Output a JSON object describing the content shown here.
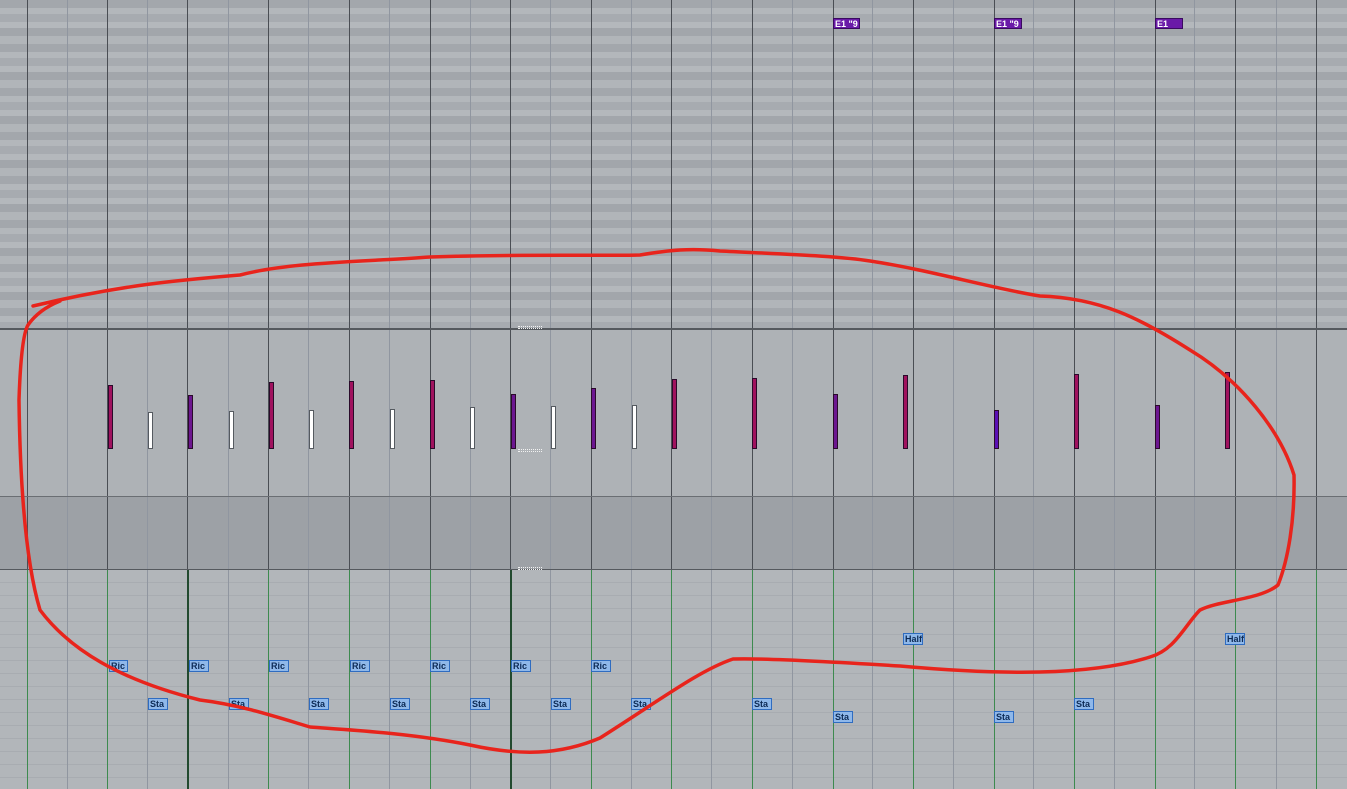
{
  "window": {
    "title": ""
  },
  "colors": {
    "velocity_magenta": "#a0125e",
    "velocity_purple": "#6c1690",
    "velocity_violet": "#5a0fb4",
    "velocity_white": "#ffffff",
    "note_block": "#6a1aa8",
    "articulation_fill": "#8fb8ea",
    "annotation_red": "#e8241c"
  },
  "notes": [
    {
      "label": "E1 \"9",
      "bar": 10
    },
    {
      "label": "E1 \"9",
      "bar": 12
    },
    {
      "label": "E1",
      "bar": 14
    }
  ],
  "velocity": [
    {
      "color": "magenta",
      "level": 0.54
    },
    {
      "color": "white",
      "level": 0.31
    },
    {
      "color": "purple",
      "level": 0.45
    },
    {
      "color": "white",
      "level": 0.32
    },
    {
      "color": "magenta",
      "level": 0.56
    },
    {
      "color": "white",
      "level": 0.33
    },
    {
      "color": "magenta",
      "level": 0.57
    },
    {
      "color": "white",
      "level": 0.34
    },
    {
      "color": "magenta",
      "level": 0.58
    },
    {
      "color": "white",
      "level": 0.35
    },
    {
      "color": "purple",
      "level": 0.46
    },
    {
      "color": "white",
      "level": 0.36
    },
    {
      "color": "purple",
      "level": 0.51
    },
    {
      "color": "white",
      "level": 0.37
    },
    {
      "color": "magenta",
      "level": 0.59
    },
    {
      "color": "magenta",
      "level": 0.6
    },
    {
      "color": "purple",
      "level": 0.46
    },
    {
      "color": "magenta",
      "level": 0.62
    },
    {
      "color": "violet",
      "level": 0.33
    },
    {
      "color": "magenta",
      "level": 0.63
    },
    {
      "color": "purple",
      "level": 0.37
    },
    {
      "color": "magenta",
      "level": 0.65
    }
  ],
  "articulations": [
    {
      "label": "Ric"
    },
    {
      "label": "Ric"
    },
    {
      "label": "Ric"
    },
    {
      "label": "Ric"
    },
    {
      "label": "Ric"
    },
    {
      "label": "Ric"
    },
    {
      "label": "Ric"
    },
    {
      "label": "Sta"
    },
    {
      "label": "Sta"
    },
    {
      "label": "Sta"
    },
    {
      "label": "Sta"
    },
    {
      "label": "Sta"
    },
    {
      "label": "Sta"
    },
    {
      "label": "Sta"
    },
    {
      "label": "Sta"
    },
    {
      "label": "Sta"
    },
    {
      "label": "Sta"
    },
    {
      "label": "Sta"
    },
    {
      "label": "Half"
    },
    {
      "label": "Half"
    }
  ],
  "annotation": {
    "shape": "freehand-loop",
    "color": "#e8241c"
  }
}
